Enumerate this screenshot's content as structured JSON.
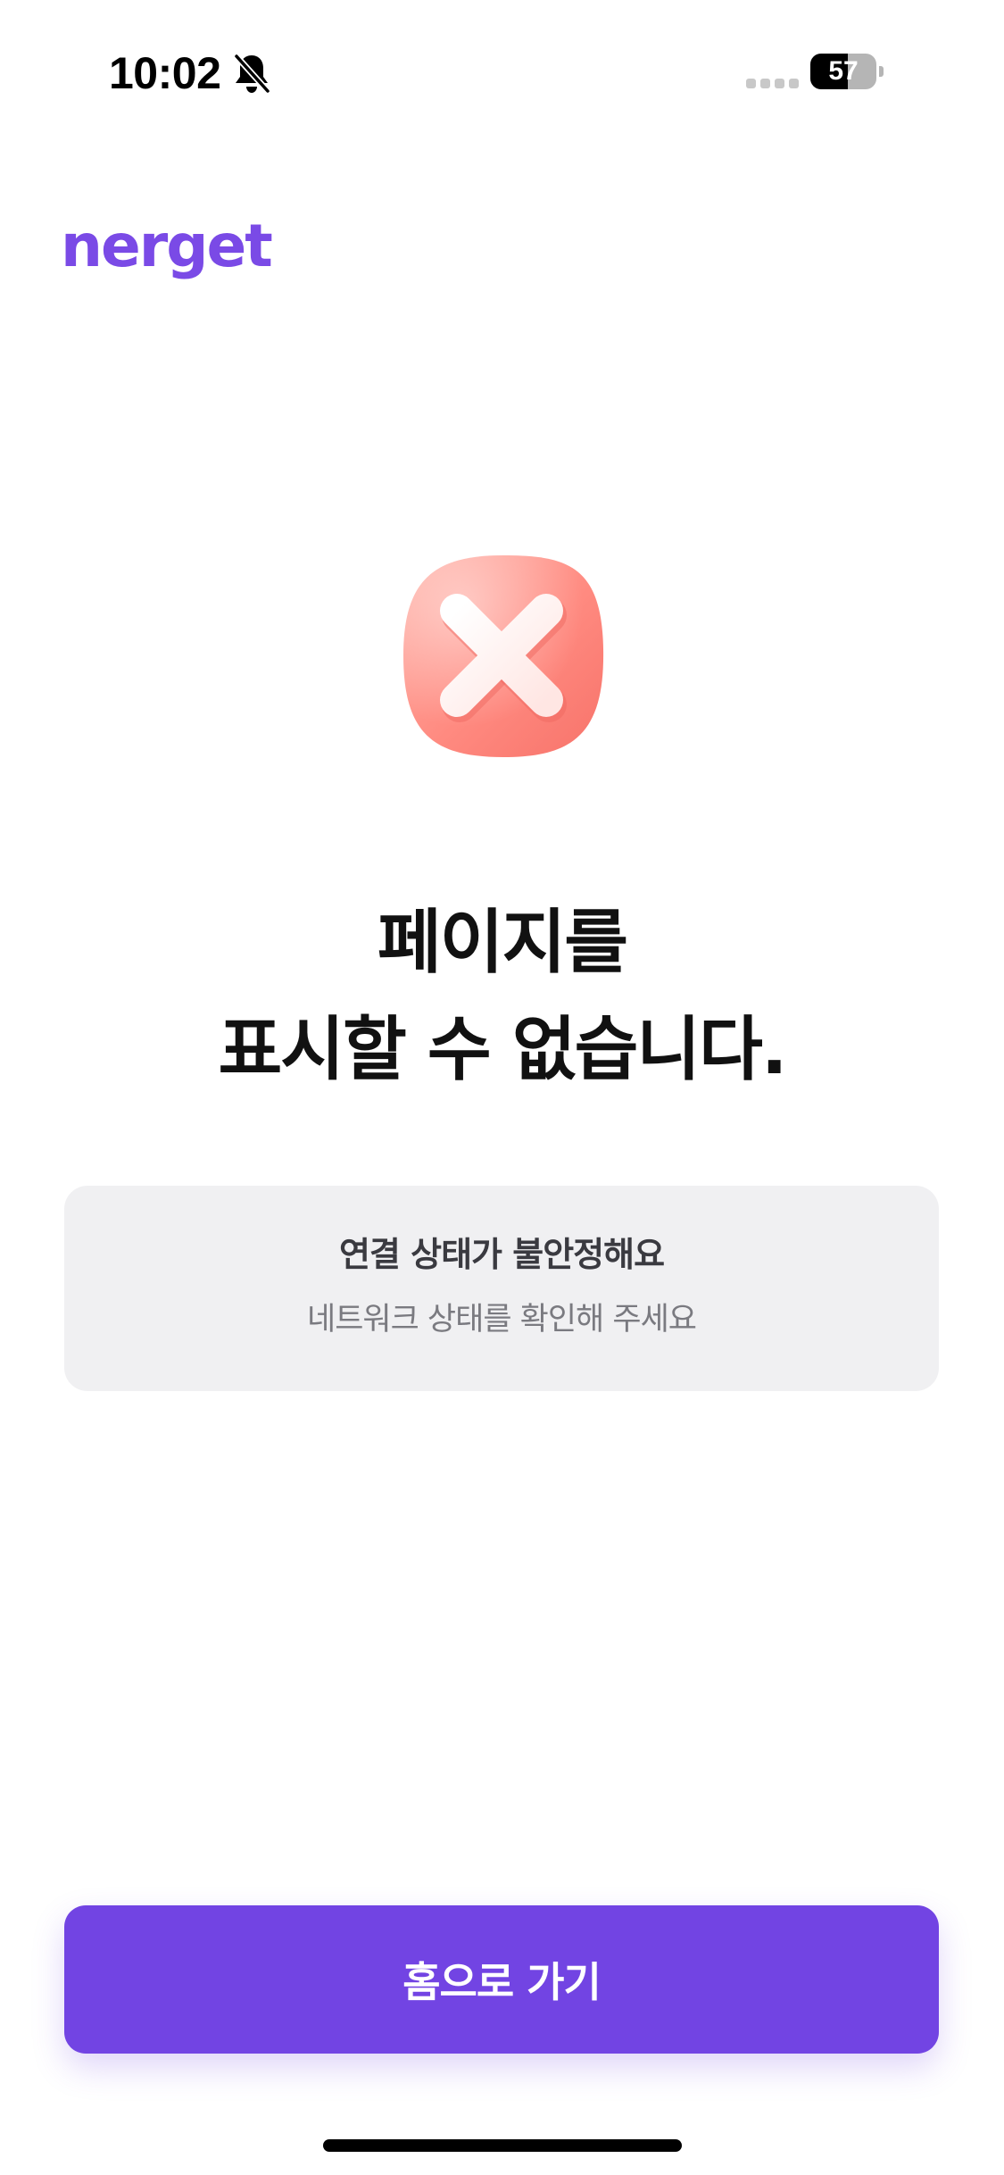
{
  "status_bar": {
    "time": "10:02",
    "battery_level": "57",
    "battery_fraction": 0.57,
    "icons": [
      "bell-slash-icon",
      "signal-icon",
      "battery-icon"
    ]
  },
  "logo": {
    "text": "nerget",
    "color": "#7a4ae6"
  },
  "error": {
    "icon": "x-mark-icon",
    "icon_color": "#ff8a80",
    "title_line1": "페이지를",
    "title_line2": "표시할 수 없습니다."
  },
  "info_card": {
    "title": "연결 상태가 불안정해요",
    "description": "네트워크 상태를 확인해 주세요"
  },
  "actions": {
    "home_label": "홈으로 가기",
    "accent_color": "#7244e3"
  }
}
